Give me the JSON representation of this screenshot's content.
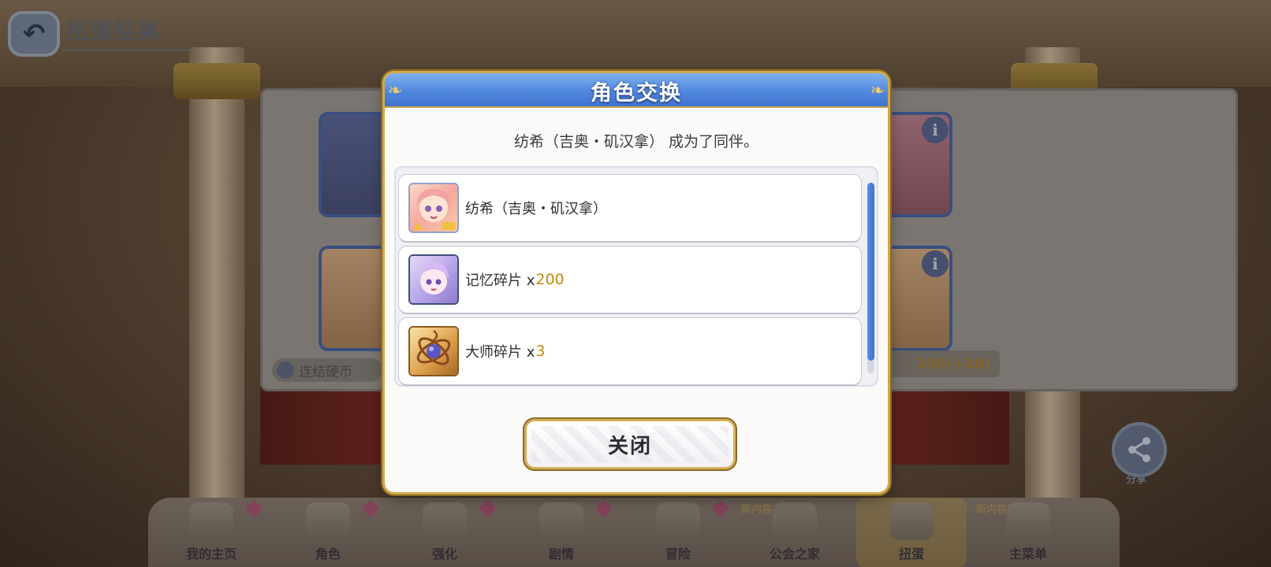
{
  "header": {
    "back_icon": "back-arrow-icon",
    "title": "扭蛋结果"
  },
  "background": {
    "coin_label": "连结硬币",
    "price_label": "200(+10)",
    "share_label": "分享",
    "nav": [
      {
        "label": "我的主页",
        "badge": "gem"
      },
      {
        "label": "角色",
        "badge": "gem"
      },
      {
        "label": "强化",
        "badge": "gem"
      },
      {
        "label": "剧情",
        "badge": "gem"
      },
      {
        "label": "冒险",
        "badge": "gem"
      },
      {
        "label": "公会之家",
        "badge": "新内容"
      },
      {
        "label": "扭蛋",
        "badge": ""
      },
      {
        "label": "主菜单",
        "badge": "新内容"
      }
    ]
  },
  "modal": {
    "title": "角色交换",
    "message": "纺希（吉奥・矶汉拿） 成为了同伴。",
    "items": [
      {
        "name": "纺希（吉奥・矶汉拿）",
        "qty": "",
        "icon": "character-portrait"
      },
      {
        "name": "记忆碎片 x",
        "qty": "200",
        "icon": "memory-shard-portrait"
      },
      {
        "name": "大师碎片 x",
        "qty": "3",
        "icon": "master-shard-orb"
      }
    ],
    "close_label": "关闭"
  },
  "colors": {
    "header_blue": "#4f86de",
    "gold_border": "#cfa94a",
    "quantity_orange": "#c48a0c"
  }
}
